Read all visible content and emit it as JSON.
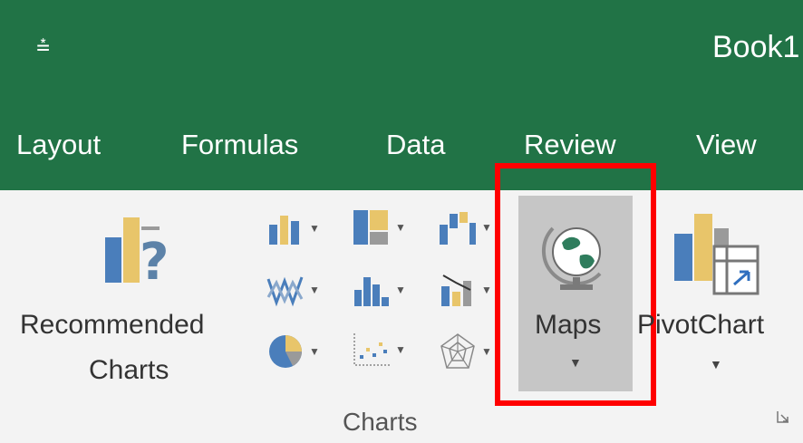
{
  "window": {
    "title": "Book1",
    "qat_glyph": "⩮"
  },
  "tabs": [
    {
      "label": "Layout"
    },
    {
      "label": "Formulas"
    },
    {
      "label": "Data"
    },
    {
      "label": "Review"
    },
    {
      "label": "View"
    }
  ],
  "charts_group": {
    "label": "Charts",
    "recommended": {
      "line1": "Recommended",
      "line2": "Charts",
      "icon": "recommended-charts-icon"
    },
    "maps": {
      "label": "Maps",
      "icon": "globe-icon"
    },
    "pivotchart": {
      "label": "PivotChart",
      "icon": "pivotchart-icon"
    }
  },
  "colors": {
    "ribbon_green": "#217346",
    "highlight_red": "#ff0000",
    "chart_blue": "#4a7ebb",
    "chart_orange": "#e8c56a",
    "chart_gray": "#9a9a9a"
  }
}
